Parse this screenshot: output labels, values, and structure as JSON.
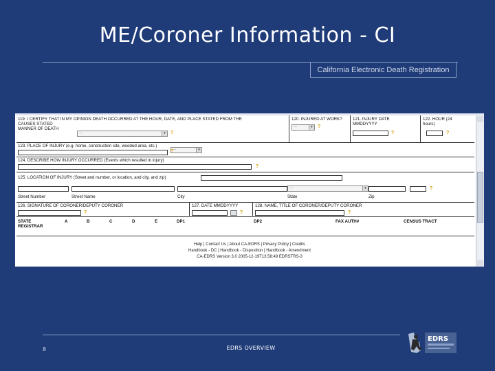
{
  "slide": {
    "title": "ME/Coroner Information - CI",
    "banner": "California Electronic Death Registration",
    "page_number": "8",
    "footer": "EDRS OVERVIEW",
    "logo_text": "EDRS"
  },
  "form": {
    "f119": "119. I CERTIFY THAT IN MY OPINION DEATH OCCURRED AT THE HOUR, DATE, AND PLACE STATED FROM THE",
    "causes_stated": "CAUSES STATED",
    "manner_of_death": "MANNER OF DEATH",
    "f120": "120. INJURED AT WORK?",
    "f121": "121. INJURY DATE",
    "f121_sub": "MMDDYYYY",
    "f122": "122. HOUR (24",
    "f122_sub": "hours)",
    "f123": "123. PLACE OF INJURY (e.g. home, construction site, wooded area, etc.)",
    "f124": "124. DESCRIBE HOW INJURY OCCURRED (Events which resulted in injury)",
    "f125": "125. LOCATION OF INJURY (Street and number, or location, and city, and zip)",
    "street_number": "Street Number",
    "street_name": "Street Name",
    "city": "City",
    "state": "State",
    "zip": "Zip",
    "f126": "126. SIGNATURE OF CORONER/DEPUTY CORONER",
    "f127": "127. DATE MMDDYYYY",
    "f128": "128. NAME, TITLE OF CORONER/DEPUTY CORONER",
    "state_registrar": "STATE REGISTRAR",
    "col_a": "A",
    "col_b": "B",
    "col_c": "C",
    "col_d": "D",
    "col_e": "E",
    "dp1": "DP1",
    "dp2": "DP2",
    "fax_auth": "FAX AUTH#",
    "census_tract": "CENSUS TRACT",
    "select_placeholder": "---",
    "help_glyph": "?"
  },
  "footer_links": {
    "line1": "Help | Contact Us | About CA-EDRS | Privacy Policy | Credits",
    "line2": "Handbook - DC | Handbook - Disposition | Handbook - Amendment",
    "line3": "CA-EDRS Version 3.0 2005-12-19T13:58:49 EDRSTRS-3"
  },
  "colors": {
    "background": "#1f3c79",
    "help_icon": "#d99a00"
  }
}
